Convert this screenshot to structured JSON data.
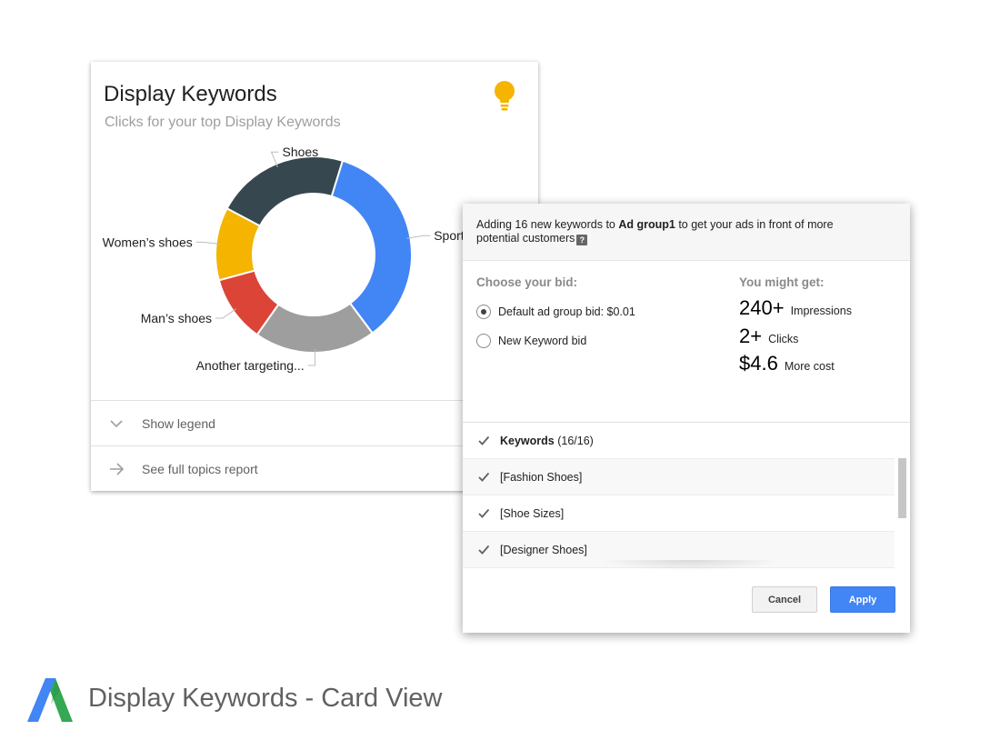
{
  "card": {
    "title": "Display Keywords",
    "subtitle": "Clicks for your top Display Keywords",
    "icon": "lightbulb-icon",
    "accent_color": "#f4b400",
    "show_legend_label": "Show legend",
    "full_report_label": "See full topics report"
  },
  "chart_data": {
    "type": "pie",
    "donut": true,
    "title": "",
    "categories": [
      "Shoes",
      "Sports",
      "Another targeting...",
      "Man's shoes",
      "Women's shoes"
    ],
    "values": [
      22,
      35,
      20,
      11,
      12
    ],
    "colors": [
      "#37474f",
      "#4285f4",
      "#9e9e9e",
      "#db4437",
      "#f4b400"
    ],
    "labels": [
      "Shoes",
      "Sports",
      "Another targeting...",
      "Man’s shoes",
      "Women’s shoes"
    ]
  },
  "dialog": {
    "header_prefix": "Adding 16 new keywords to ",
    "header_group": "Ad group1",
    "header_suffix": " to get your ads in front of more potential customers",
    "help_icon": "?",
    "bid_label": "Choose your bid:",
    "bid_options": [
      {
        "label": "Default ad group bid: $0.01",
        "selected": true
      },
      {
        "label": "New Keyword bid",
        "selected": false
      }
    ],
    "might_get_label": "You might get:",
    "stats": [
      {
        "value": "240+",
        "unit": "Impressions"
      },
      {
        "value": "2+",
        "unit": "Clicks"
      },
      {
        "value": "$4.6",
        "unit": "More cost"
      }
    ],
    "keywords_header_label": "Keywords",
    "keywords_header_count": " (16/16)",
    "keywords": [
      "[Fashion Shoes]",
      "[Shoe Sizes]",
      "[Designer Shoes]"
    ],
    "cancel_label": "Cancel",
    "apply_label": "Apply"
  },
  "branding": {
    "title": "Display Keywords - Card View"
  }
}
